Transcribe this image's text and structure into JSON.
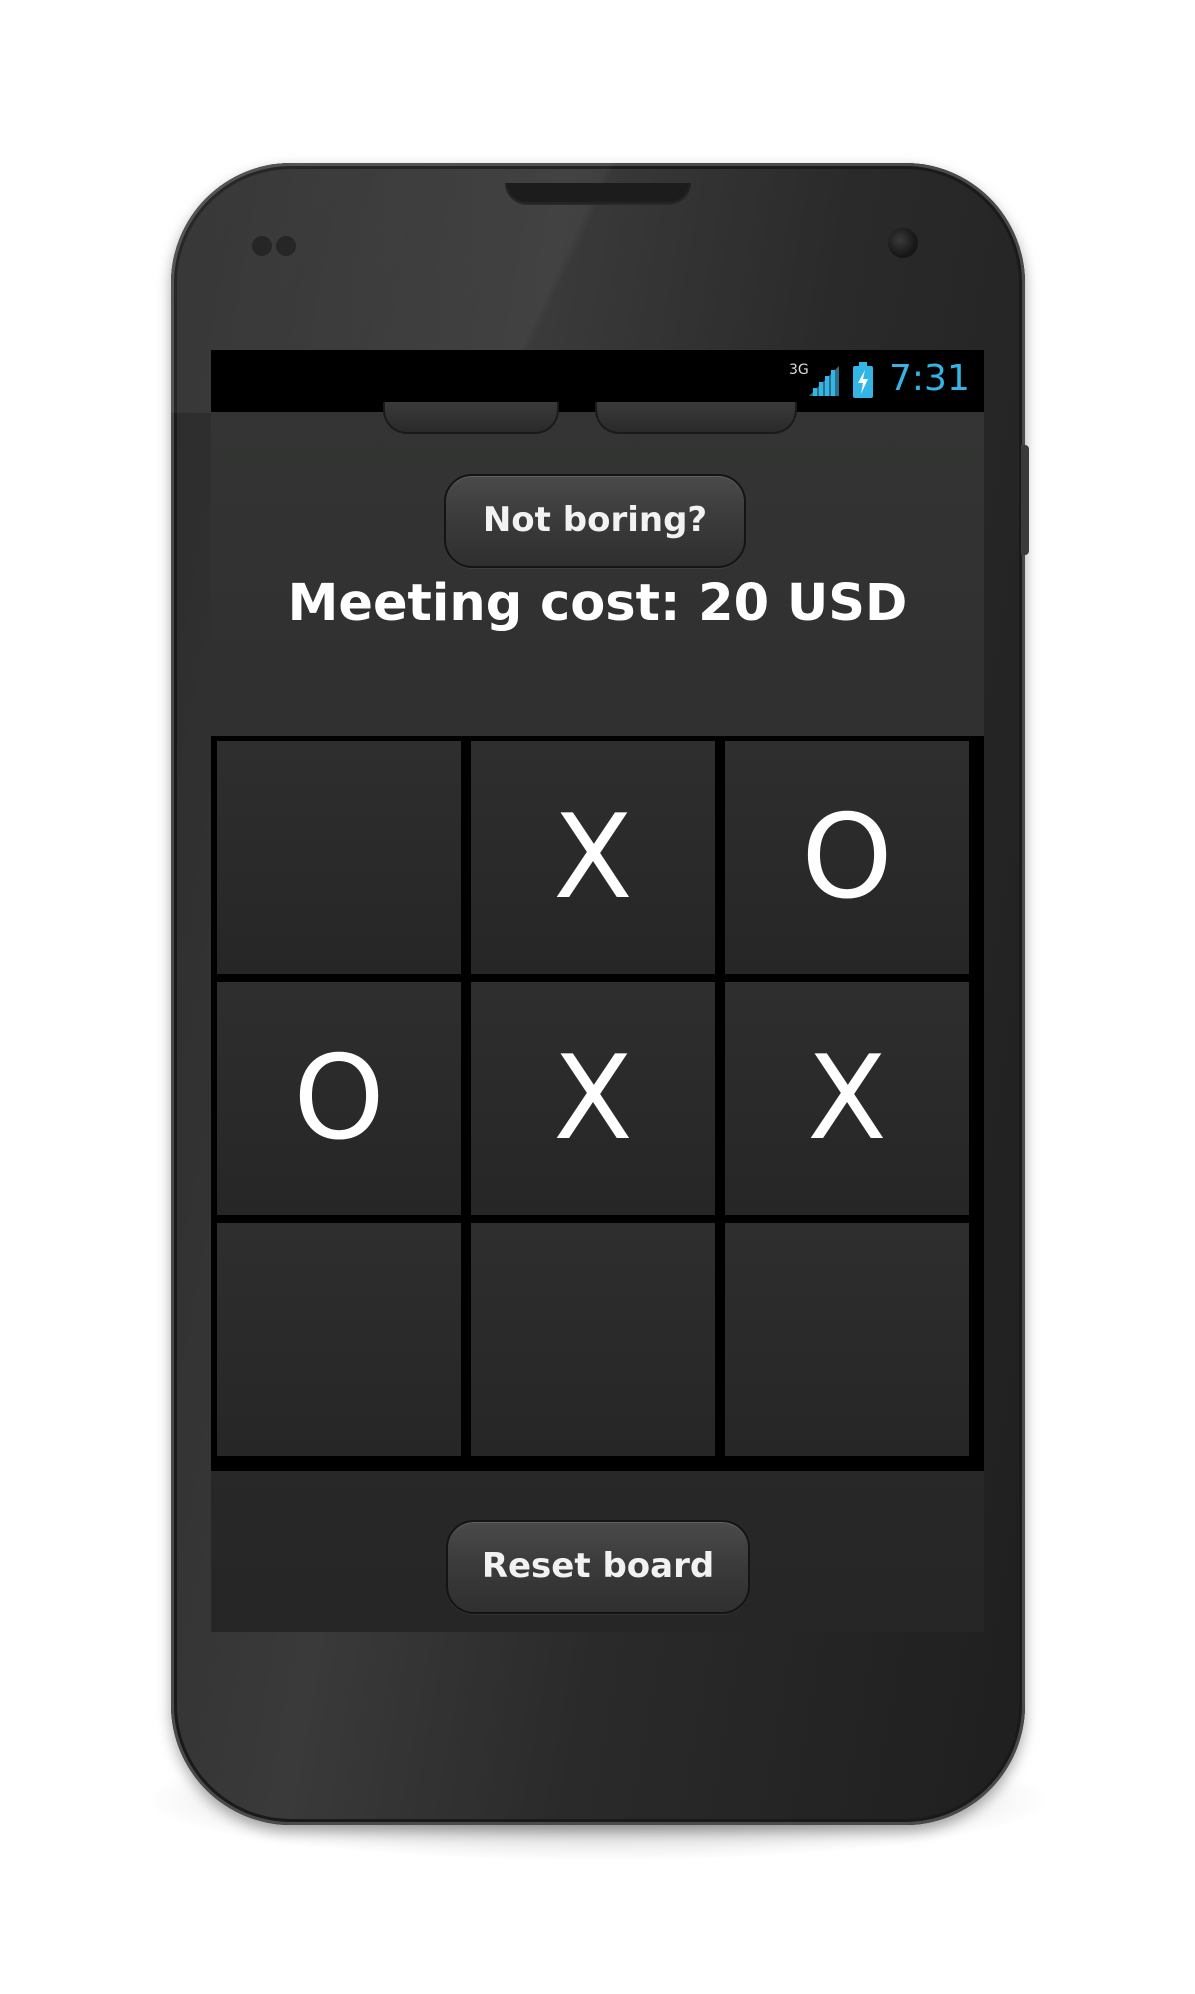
{
  "status_bar": {
    "network_type": "3G",
    "clock": "7:31",
    "signal_icon": "signal-bars-icon",
    "battery_icon": "battery-charging-icon"
  },
  "app": {
    "not_boring_button": "Not boring?",
    "meeting_cost_text": "Meeting cost: 20 USD",
    "reset_button": "Reset board"
  },
  "board": {
    "cells": [
      "",
      "X",
      "O",
      "O",
      "X",
      "X",
      "",
      "",
      ""
    ]
  },
  "colors": {
    "clock": "#33b5e5",
    "background": "#2a2a2a",
    "text": "#ffffff"
  }
}
